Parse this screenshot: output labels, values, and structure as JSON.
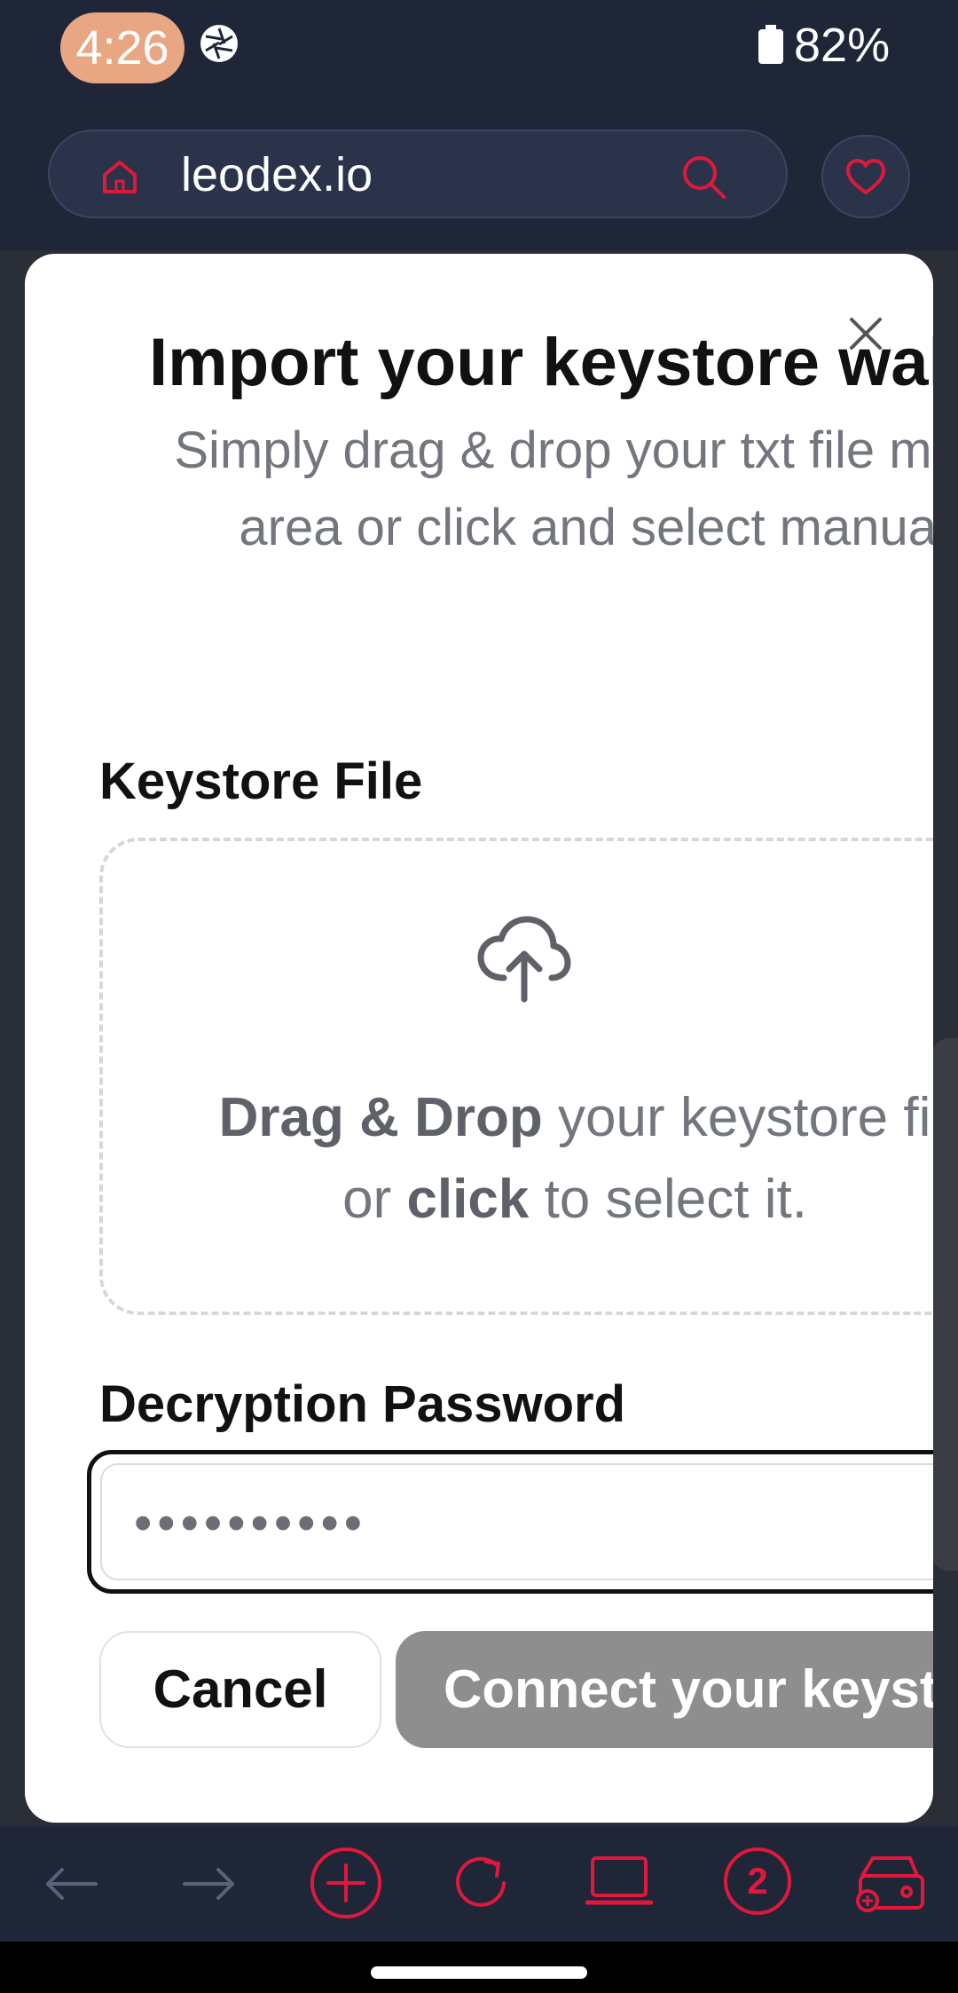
{
  "status_bar": {
    "time": "4:26",
    "battery": "82%",
    "icons": [
      "aperture-icon",
      "battery-icon"
    ]
  },
  "browser": {
    "url": "leodex.io",
    "icons": [
      "home-icon",
      "search-icon",
      "heart-icon"
    ],
    "accent_color": "#e0193c"
  },
  "modal": {
    "title": "Import your keystore wal",
    "subtitle": "Simply drag & drop your txt file marked area or click and select manually.",
    "keystore_label": "Keystore File",
    "dropzone": {
      "bold_1": "Drag & Drop",
      "text_1": " your keystore fi",
      "text_2": "or ",
      "bold_2": "click",
      "text_3": " to select it."
    },
    "password_label": "Decryption Password",
    "password_value": "••••••••••",
    "cancel_label": "Cancel",
    "connect_label": "Connect your keyst"
  },
  "toolbar": {
    "icons": [
      "back-arrow-icon",
      "forward-arrow-icon",
      "new-tab-icon",
      "reload-icon",
      "desktop-icon",
      "tabs-count-icon",
      "wallet-icon"
    ],
    "tab_count": "2"
  }
}
